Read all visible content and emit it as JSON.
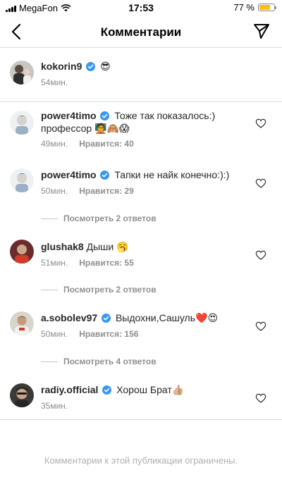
{
  "status_bar": {
    "carrier": "MegaFon",
    "time": "17:53",
    "battery_text": "77 %",
    "battery_level": 0.77
  },
  "header": {
    "title": "Комментарии",
    "back_icon": "chevron-left-icon",
    "send_icon": "send-icon"
  },
  "caption": {
    "username": "kokorin9",
    "text": "😎",
    "time": "54мин."
  },
  "comments": [
    {
      "username": "power4timo",
      "text": "Тоже так показалось:) профессор 🧑‍🏫🙈😱",
      "time": "49мин.",
      "likes": "Нравится: 40"
    },
    {
      "username": "power4timo",
      "text": "Тапки не найк конечно:):)",
      "time": "50мин.",
      "likes": "Нравится: 29",
      "replies": "Посмотреть 2 ответов"
    },
    {
      "username": "glushak8",
      "text": "Дыши 🥱",
      "time": "51мин.",
      "likes": "Нравится: 55",
      "replies": "Посмотреть 2 ответов"
    },
    {
      "username": "a.sobolev97",
      "text": "Выдохни,Сашуль❤️😍",
      "time": "50мин.",
      "likes": "Нравится: 156",
      "replies": "Посмотреть 4 ответов"
    },
    {
      "username": "radiy.official",
      "text": "Хорош Брат👍🏼",
      "time": "35мин."
    }
  ],
  "footer": {
    "note": "Комментарии к этой публикации ограничены."
  },
  "colors": {
    "verified": "#3897f0",
    "meta_text": "#8e8e8e",
    "divider": "#dbdbdb",
    "battery": "#f5c300"
  }
}
